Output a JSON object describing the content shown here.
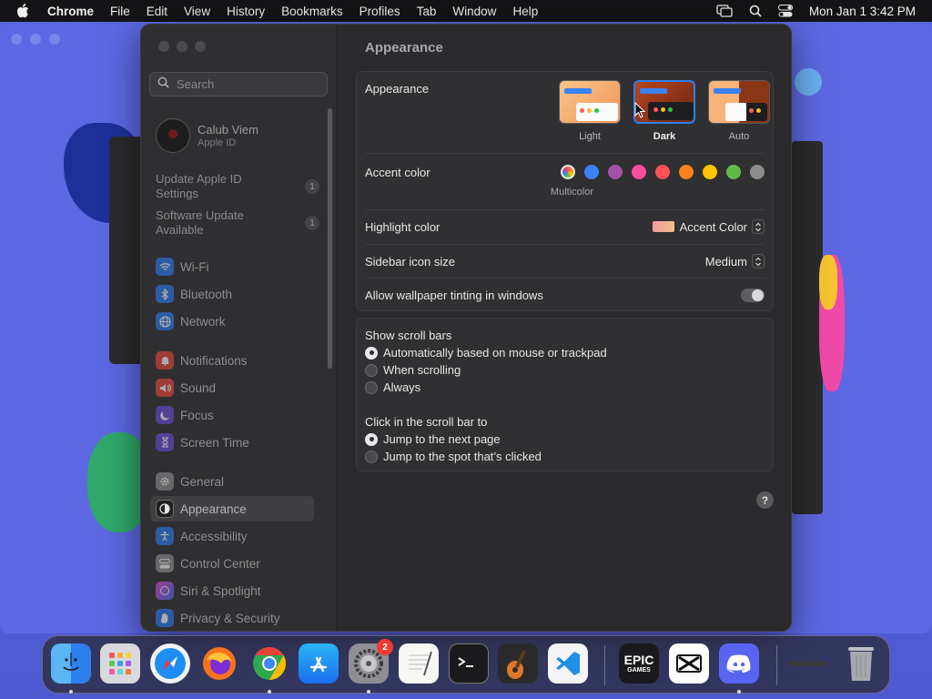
{
  "menubar": {
    "app_name": "Chrome",
    "items": [
      "File",
      "Edit",
      "View",
      "History",
      "Bookmarks",
      "Profiles",
      "Tab",
      "Window",
      "Help"
    ],
    "datetime": "Mon Jan 1  3:42 PM"
  },
  "sidebar": {
    "search_placeholder": "Search",
    "user_name": "Calub Viem",
    "user_sub": "Apple ID",
    "notices": [
      {
        "label": "Update Apple ID Settings",
        "count": "1"
      },
      {
        "label": "Software Update Available",
        "count": "1"
      }
    ],
    "items": [
      {
        "label": "Wi-Fi",
        "color": "#2b7bf0"
      },
      {
        "label": "Bluetooth",
        "color": "#2b7bf0"
      },
      {
        "label": "Network",
        "color": "#2b7bf0"
      },
      {
        "label": "Notifications",
        "color": "#e8453c"
      },
      {
        "label": "Sound",
        "color": "#e8453c"
      },
      {
        "label": "Focus",
        "color": "#6a4cd8"
      },
      {
        "label": "Screen Time",
        "color": "#6a4cd8"
      },
      {
        "label": "General",
        "color": "#8e8e93"
      },
      {
        "label": "Appearance",
        "color": "#1c1c1e"
      },
      {
        "label": "Accessibility",
        "color": "#2b7bf0"
      },
      {
        "label": "Control Center",
        "color": "#8e8e93"
      },
      {
        "label": "Siri & Spotlight",
        "color": "#c04bd8"
      },
      {
        "label": "Privacy & Security",
        "color": "#2b7bf0"
      }
    ],
    "selected": "Appearance"
  },
  "content": {
    "title": "Appearance",
    "appearance": {
      "label": "Appearance",
      "options": [
        "Light",
        "Dark",
        "Auto"
      ],
      "selected": "Dark"
    },
    "accent": {
      "label": "Accent color",
      "multicolor_caption": "Multicolor",
      "colors": [
        "#3a82f7",
        "#a550a7",
        "#f74f9e",
        "#ff5257",
        "#f7821b",
        "#ffc600",
        "#62ba46",
        "#8c8c8c"
      ]
    },
    "highlight": {
      "label": "Highlight color",
      "value": "Accent Color"
    },
    "sidebar_icon": {
      "label": "Sidebar icon size",
      "value": "Medium"
    },
    "tinting": {
      "label": "Allow wallpaper tinting in windows"
    },
    "scroll_bars": {
      "title": "Show scroll bars",
      "options": [
        "Automatically based on mouse or trackpad",
        "When scrolling",
        "Always"
      ],
      "selected_index": 0
    },
    "click_scroll": {
      "title": "Click in the scroll bar to",
      "options": [
        "Jump to the next page",
        "Jump to the spot that’s clicked"
      ],
      "selected_index": 0
    },
    "help": "?"
  },
  "dock": {
    "settings_badge": "2",
    "epic_line1": "EPIC",
    "epic_line2": "GAMES"
  }
}
